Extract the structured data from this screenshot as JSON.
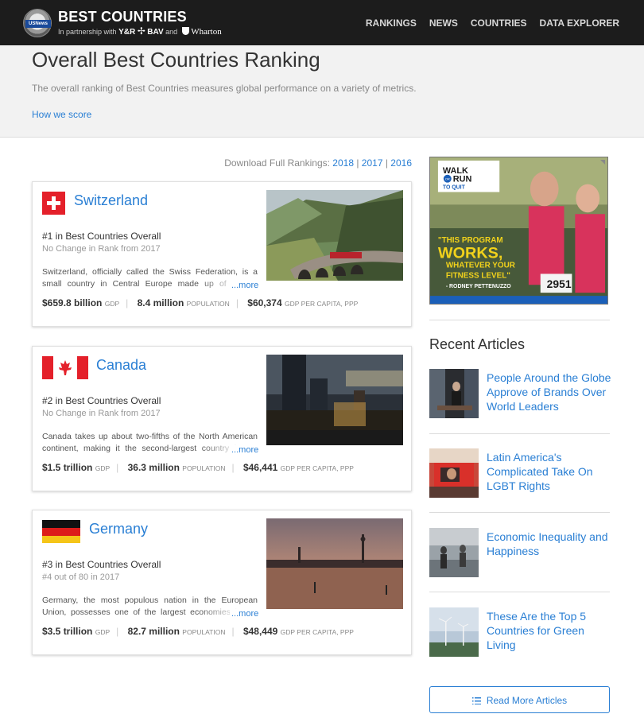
{
  "brand": {
    "seal_text": "USNews",
    "title": "BEST COUNTRIES",
    "partnership_prefix": "In partnership with",
    "partner1": "Y&R",
    "partner2": "BAV",
    "and_text": "and",
    "partner3": "Wharton"
  },
  "nav": [
    "RANKINGS",
    "NEWS",
    "COUNTRIES",
    "DATA EXPLORER"
  ],
  "hero": {
    "title": "Overall Best Countries Ranking",
    "description": "The overall ranking of Best Countries measures global performance on a variety of metrics.",
    "how_we_score": "How we score"
  },
  "download": {
    "label": "Download Full Rankings:",
    "years": [
      "2018",
      "2017",
      "2016"
    ]
  },
  "countries": [
    {
      "name": "Switzerland",
      "rank_text": "#1 in Best Countries Overall",
      "change_text": "No Change in Rank from 2017",
      "blurb": "Switzerland, officially called the Swiss Federation, is a small country in Central Europe made up of 16,000 square miles of varied terrain, including the Alps.",
      "more": "...more",
      "gdp": "$659.8 billion",
      "gdp_label": "GDP",
      "population": "8.4 million",
      "population_label": "POPULATION",
      "per_capita": "$60,374",
      "per_capita_label": "GDP PER CAPITA, PPP"
    },
    {
      "name": "Canada",
      "rank_text": "#2 in Best Countries Overall",
      "change_text": "No Change in Rank from 2017",
      "blurb": "Canada takes up about two-fifths of the North American continent, making it the second-largest country in the world after Russia.",
      "more": "...more",
      "gdp": "$1.5 trillion",
      "gdp_label": "GDP",
      "population": "36.3 million",
      "population_label": "POPULATION",
      "per_capita": "$46,441",
      "per_capita_label": "GDP PER CAPITA, PPP"
    },
    {
      "name": "Germany",
      "rank_text": "#3 in Best Countries Overall",
      "change_text": "#4 out of 80 in 2017",
      "blurb": "Germany, the most populous nation in the European Union, possesses one of the largest economies in the world.",
      "more": "...more",
      "gdp": "$3.5 trillion",
      "gdp_label": "GDP",
      "population": "82.7 million",
      "population_label": "POPULATION",
      "per_capita": "$48,449",
      "per_capita_label": "GDP PER CAPITA, PPP"
    }
  ],
  "ad": {
    "logo_line1": "WALK",
    "logo_or": "OR",
    "logo_line2": "RUN",
    "logo_line3": "TO QUIT",
    "quote1": "\"THIS PROGRAM",
    "quote2": "WORKS,",
    "quote3": "WHATEVER YOUR",
    "quote4": "FITNESS LEVEL\"",
    "attribution": "- RODNEY PETTENUZZO",
    "bib": "2951"
  },
  "recent": {
    "title": "Recent Articles",
    "articles": [
      "People Around the Globe Approve of Brands Over World Leaders",
      "Latin America's Complicated Take On LGBT Rights",
      "Economic Inequality and Happiness",
      "These Are the Top 5 Countries for Green Living"
    ],
    "read_more": "Read More Articles"
  },
  "colors": {
    "accent": "#2a7fd4",
    "nav_bg": "#1c1c1c",
    "hero_bg": "#f2f2f2"
  }
}
